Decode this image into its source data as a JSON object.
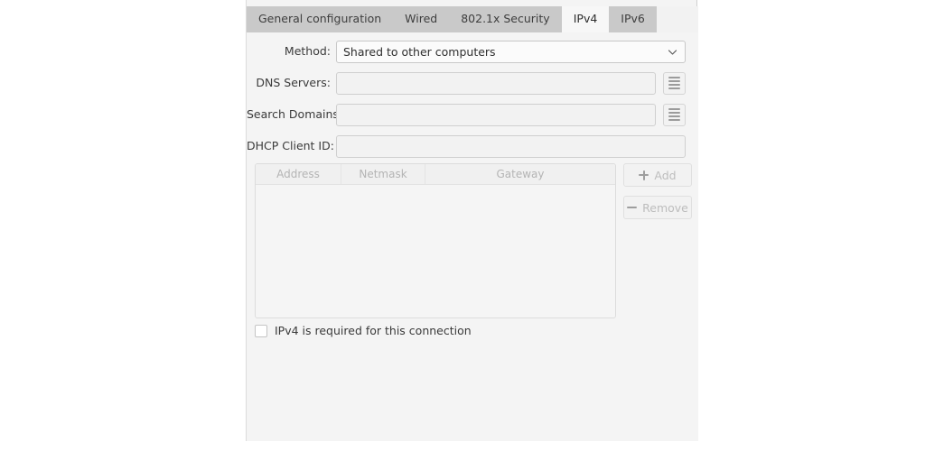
{
  "tabs": [
    {
      "label": "General configuration",
      "active": false
    },
    {
      "label": "Wired",
      "active": false
    },
    {
      "label": "802.1x Security",
      "active": false
    },
    {
      "label": "IPv4",
      "active": true
    },
    {
      "label": "IPv6",
      "active": false
    }
  ],
  "form": {
    "method": {
      "label": "Method:",
      "value": "Shared to other computers",
      "icon": "chevron-down-icon"
    },
    "dns_servers": {
      "label": "DNS Servers:",
      "value": "",
      "placeholder": "",
      "button_icon": "hamburger-menu-icon"
    },
    "search_domains": {
      "label": "Search Domains:",
      "value": "",
      "placeholder": "",
      "button_icon": "hamburger-menu-icon"
    },
    "dhcp_client_id": {
      "label": "DHCP Client ID:",
      "value": "",
      "placeholder": ""
    }
  },
  "address_table": {
    "columns": [
      "Address",
      "Netmask",
      "Gateway"
    ],
    "rows": []
  },
  "actions": {
    "add": {
      "label": "Add",
      "icon": "plus-icon",
      "enabled": false
    },
    "remove": {
      "label": "Remove",
      "icon": "minus-icon",
      "enabled": false
    }
  },
  "checkbox": {
    "label": "IPv4 is required for this connection",
    "checked": false
  },
  "colors": {
    "panel_bg": "#f4f4f4",
    "tab_inactive_bg": "#c9c9c9",
    "tab_active_bg": "#f7f7f7",
    "field_bg": "#f2f2f2",
    "field_border": "#cfcfcf",
    "text": "#3a3a3a",
    "muted_text": "#b4b4b4"
  }
}
